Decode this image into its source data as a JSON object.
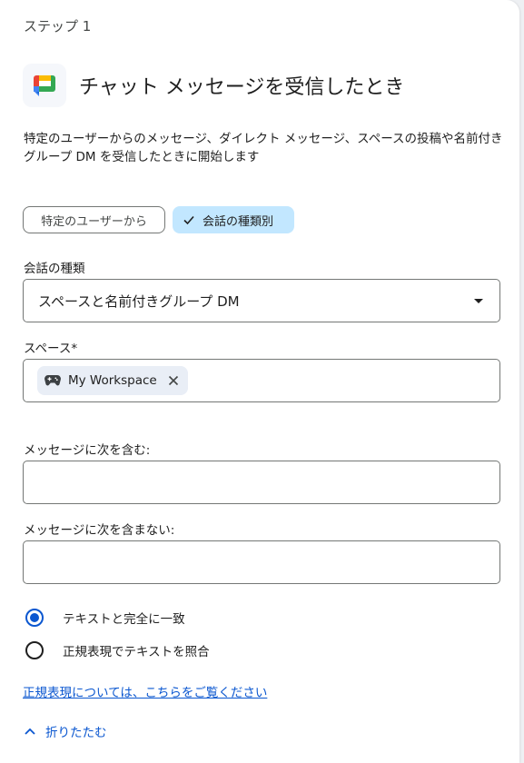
{
  "step": {
    "label": "ステップ 1"
  },
  "trigger": {
    "title": "チャット メッセージを受信したとき",
    "description": "特定のユーザーからのメッセージ、ダイレクト メッセージ、スペースの投稿や名前付きグループ DM を受信したときに開始します",
    "icon": "google-chat-icon"
  },
  "filter_chips": {
    "from_user": "特定のユーザーから",
    "by_conversation_type": "会話の種類別",
    "selected": "by_conversation_type"
  },
  "conversation_type": {
    "label": "会話の種類",
    "value": "スペースと名前付きグループ DM"
  },
  "spaces": {
    "label": "スペース*",
    "chips": [
      {
        "icon": "gamepad-icon",
        "name": "My Workspace"
      }
    ]
  },
  "contains": {
    "label": "メッセージに次を含む:",
    "value": ""
  },
  "not_contains": {
    "label": "メッセージに次を含まない:",
    "value": ""
  },
  "match_mode": {
    "options": [
      {
        "label": "テキストと完全に一致",
        "checked": true
      },
      {
        "label": "正規表現でテキストを照合",
        "checked": false
      }
    ]
  },
  "regex_help_link": "正規表現については、こちらをご覧ください",
  "collapse_label": "折りたたむ",
  "colors": {
    "accent": "#0b57d0",
    "chip_selected_bg": "#c2e7ff",
    "space_chip_bg": "#e9eef6",
    "outline": "#747775"
  }
}
